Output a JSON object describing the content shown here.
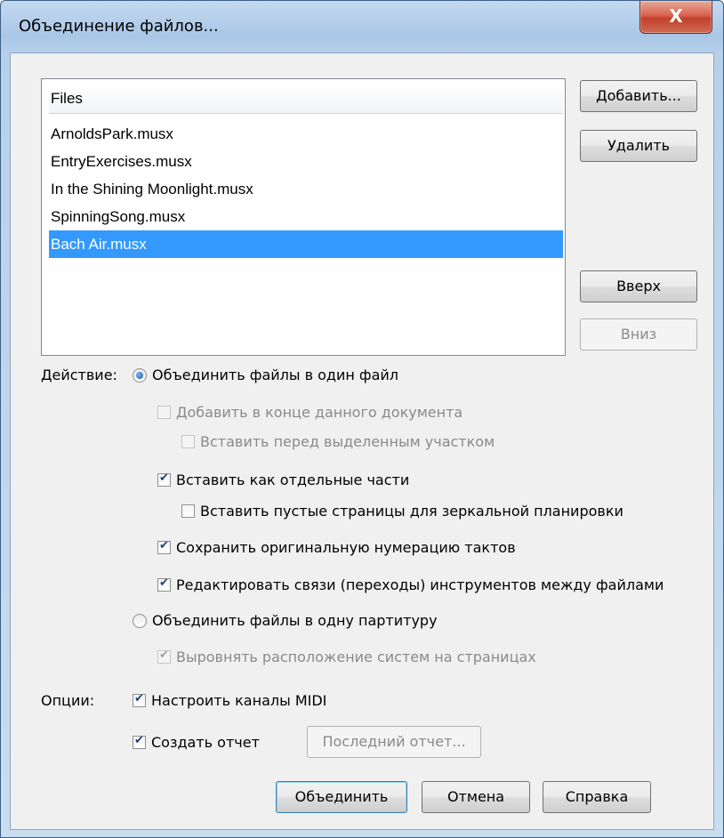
{
  "window": {
    "title": "Объединение файлов...",
    "close_glyph": "X"
  },
  "files": {
    "header": "Files",
    "items": [
      "ArnoldsPark.musx",
      "EntryExercises.musx",
      "In the Shining Moonlight.musx",
      "SpinningSong.musx",
      "Bach Air.musx"
    ],
    "selected_index": 4
  },
  "side_buttons": {
    "add": "Добавить...",
    "remove": "Удалить",
    "up": "Вверх",
    "down": "Вниз"
  },
  "action": {
    "label": "Действие:",
    "merge_one_file": "Объединить файлы в один файл",
    "append_end": "Добавить в конце данного документа",
    "insert_before": "Вставить перед выделенным участком",
    "insert_as_parts": "Вставить как отдельные части",
    "insert_blank_pages": "Вставить пустые страницы для зеркальной планировки",
    "keep_numbering": "Сохранить оригинальную нумерацию тактов",
    "edit_links": "Редактировать связи (переходы) инструментов между файлами",
    "merge_one_score": "Объединить файлы в одну партитуру",
    "align_systems": "Выровнять расположение систем на страницах"
  },
  "options": {
    "label": "Опции:",
    "midi_channels": "Настроить каналы MIDI",
    "create_report": "Создать отчет",
    "last_report": "Последний отчет..."
  },
  "footer": {
    "merge": "Объединить",
    "cancel": "Отмена",
    "help": "Справка"
  }
}
